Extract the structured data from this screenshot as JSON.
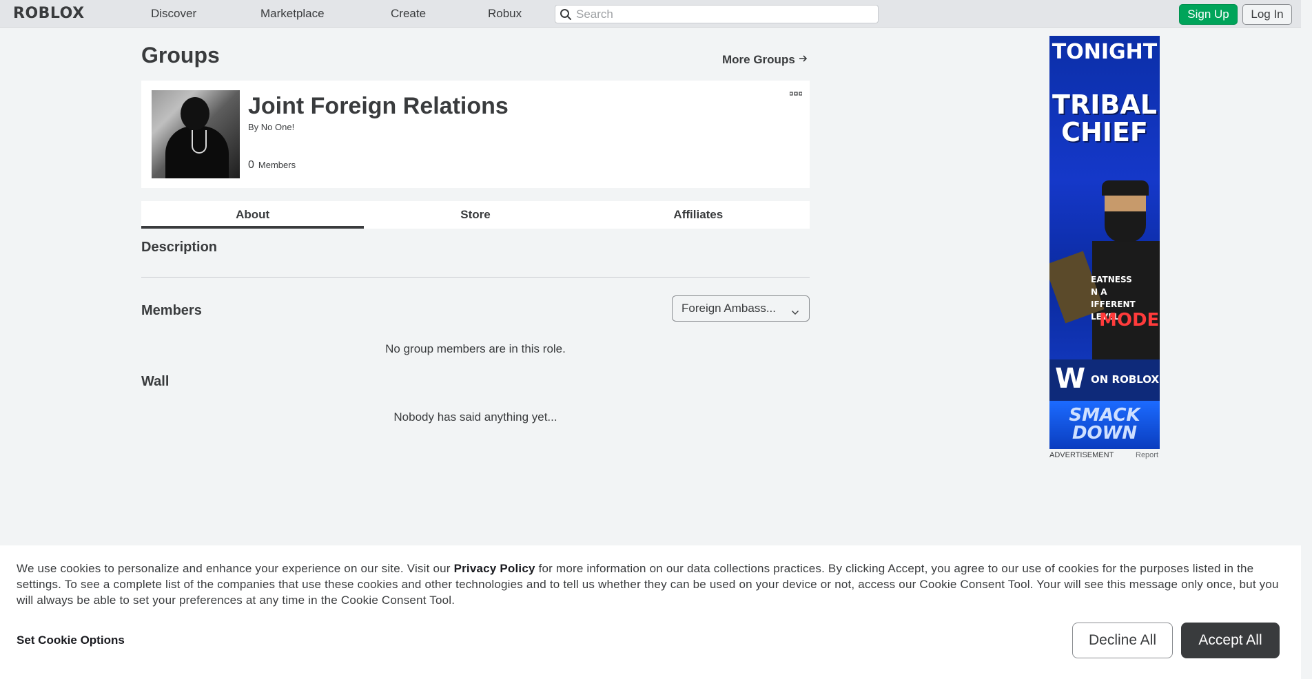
{
  "nav": {
    "logo": "ROBLOX",
    "links": [
      "Discover",
      "Marketplace",
      "Create",
      "Robux"
    ],
    "search_placeholder": "Search",
    "sign_up": "Sign Up",
    "log_in": "Log In"
  },
  "page": {
    "title": "Groups",
    "more_groups": "More Groups"
  },
  "group": {
    "name": "Joint Foreign Relations",
    "owner": "By No One!",
    "member_count": "0",
    "members_label": "Members"
  },
  "tabs": [
    "About",
    "Store",
    "Affiliates"
  ],
  "about": {
    "description_title": "Description",
    "members_title": "Members",
    "role_selected": "Foreign Ambass...",
    "no_members": "No group members are in this role.",
    "wall_title": "Wall",
    "wall_empty": "Nobody has said anything yet..."
  },
  "ad": {
    "line1": "TONIGHT",
    "line2": "TRIBAL",
    "line3": "CHIEF",
    "slogan1": "EATNESS",
    "slogan2": "N A",
    "slogan3": "IFFERENT LEVEL",
    "mode": "MODE",
    "wwe": "W",
    "on_roblox": "ON ROBLOX",
    "smack": "SMACK",
    "down": "DOWN",
    "label": "ADVERTISEMENT",
    "report": "Report"
  },
  "cookie": {
    "text_before": "We use cookies to personalize and enhance your experience on our site. Visit our ",
    "privacy_policy": "Privacy Policy",
    "text_after": " for more information on our data collections practices. By clicking Accept, you agree to our use of cookies for the purposes listed in the settings. To see a complete list of the companies that use these cookies and other technologies and to tell us whether they can be used on your device or not, access our Cookie Consent Tool. Your will see this message only once, but you will always be able to set your preferences at any time in the Cookie Consent Tool.",
    "set_options": "Set Cookie Options",
    "decline": "Decline All",
    "accept": "Accept All"
  },
  "colors": {
    "sign_up_green": "#00a45a",
    "page_bg": "#f2f4f5",
    "text_dark": "#393b3d"
  }
}
